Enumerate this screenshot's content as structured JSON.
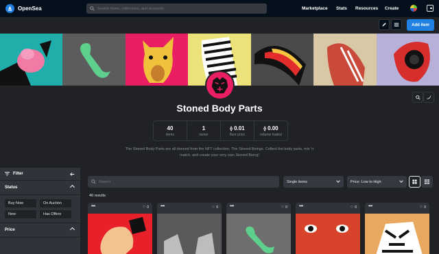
{
  "app": {
    "name": "OpenSea"
  },
  "search": {
    "placeholder": "Search items, collections, and accounts"
  },
  "nav": [
    "Marketplace",
    "Stats",
    "Resources",
    "Create"
  ],
  "actions": {
    "add_item": "Add item"
  },
  "collection": {
    "title": "Stoned Body Parts",
    "description": "The Stoned Body Parts are all derived from the NFT collection, The Stoned Beings. Collect the body parts, mix 'n match, and create your very own Stoned Being!",
    "stats": [
      {
        "value": "40",
        "label": "items"
      },
      {
        "value": "1",
        "label": "owner"
      },
      {
        "value": "0.01",
        "label": "floor price",
        "currency": "eth"
      },
      {
        "value": "0.00",
        "label": "volume traded",
        "currency": "eth"
      }
    ]
  },
  "sidebar": {
    "filter_label": "Filter",
    "status_label": "Status",
    "status_options": [
      "Buy Now",
      "On Auction",
      "New",
      "Has Offers"
    ],
    "price_label": "Price"
  },
  "toolbar": {
    "search_placeholder": "Search",
    "type_select": "Single items",
    "sort_select": "Price: Low to High"
  },
  "results": {
    "count_text": "40 results"
  },
  "cards": [
    {
      "likes": "0",
      "bg": "#e8202a"
    },
    {
      "likes": "0",
      "bg": "#5a5a5a"
    },
    {
      "likes": "0",
      "bg": "#6e6e6e"
    },
    {
      "likes": "0",
      "bg": "#d7442b"
    },
    {
      "likes": "0",
      "bg": "#e8a860"
    }
  ],
  "colors": {
    "accent": "#2081e2",
    "header": "#04111d",
    "background": "#202225"
  }
}
